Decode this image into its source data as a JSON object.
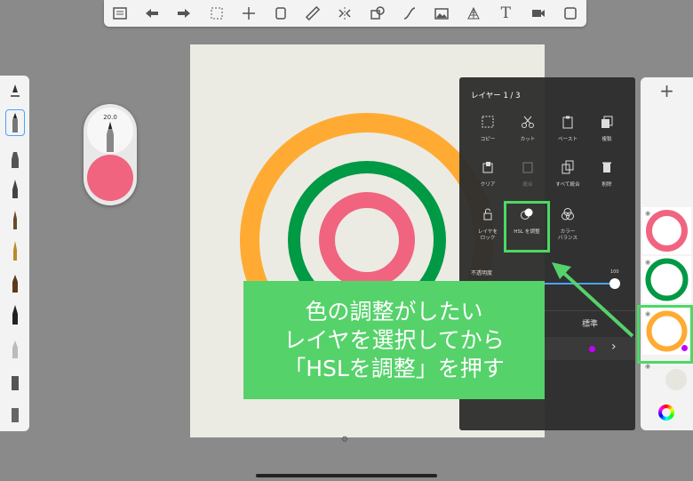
{
  "toolbar": {
    "icons": [
      "list-icon",
      "undo-icon",
      "redo-icon",
      "select-icon",
      "transform-icon",
      "copy-layer-icon",
      "ruler-icon",
      "symmetry-icon",
      "shape-icon",
      "curve-icon",
      "image-icon",
      "perspective-icon",
      "text-icon",
      "video-icon",
      "fullscreen-icon"
    ],
    "text_tool_label": "T"
  },
  "brush_panel": {
    "selected_index": 1
  },
  "puck": {
    "size": "20.0",
    "color": "#f06480"
  },
  "canvas": {
    "background": "#ecebe3",
    "ring_colors": [
      "#ffab33",
      "#009944",
      "#f06480"
    ]
  },
  "layer_menu": {
    "title": "レイヤー 1 / 3",
    "items": [
      {
        "label": "コピー",
        "icon": "copy-icon"
      },
      {
        "label": "カット",
        "icon": "scissors-icon"
      },
      {
        "label": "ペースト",
        "icon": "paste-icon"
      },
      {
        "label": "複製",
        "icon": "duplicate-icon"
      },
      {
        "label": "クリア",
        "icon": "clear-icon"
      },
      {
        "label": "統合",
        "icon": "merge-icon"
      },
      {
        "label": "すべて統合",
        "icon": "merge-all-icon"
      },
      {
        "label": "削除",
        "icon": "trash-icon"
      },
      {
        "label": "レイヤを\nロック",
        "icon": "lock-icon"
      },
      {
        "label": "HSL を調整",
        "icon": "hsl-icon"
      },
      {
        "label": "カラー\nバランス",
        "icon": "color-balance-icon"
      }
    ],
    "opacity_label": "不透明度",
    "opacity_max": "100",
    "opacity_value": 1.0,
    "blend_mode": "標準",
    "layer_color": "#c400ff"
  },
  "layers_panel": {
    "add_label": "+",
    "layers": [
      {
        "ring_color": "#f06480"
      },
      {
        "ring_color": "#009944"
      },
      {
        "ring_color": "#ffab33"
      }
    ]
  },
  "callout": {
    "lines": [
      "色の調整がしたい",
      "レイヤを選択してから",
      "「HSLを調整」を押す"
    ]
  }
}
